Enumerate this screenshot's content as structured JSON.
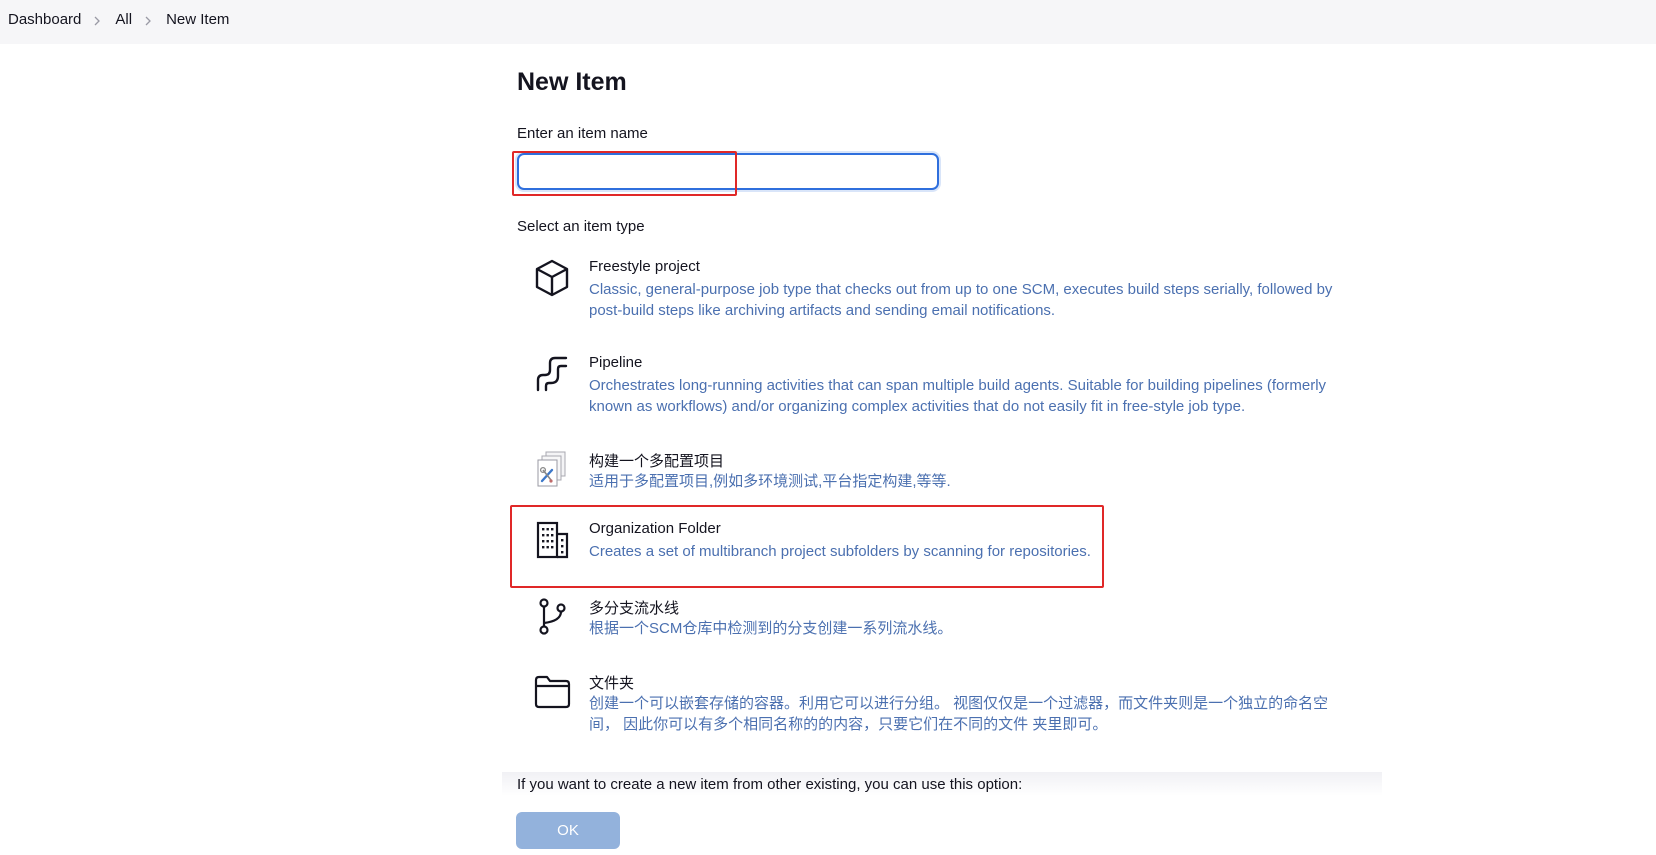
{
  "breadcrumb": {
    "items": [
      "Dashboard",
      "All",
      "New Item"
    ]
  },
  "page": {
    "title": "New Item",
    "name_label": "Enter an item name",
    "name_value": "",
    "type_label": "Select an item type"
  },
  "item_types": [
    {
      "icon": "cube-icon",
      "name": "Freestyle project",
      "desc": "Classic, general-purpose job type that checks out from up to one SCM, executes build steps serially, followed by post-build steps like archiving artifacts and sending email notifications."
    },
    {
      "icon": "pipeline-icon",
      "name": "Pipeline",
      "desc": "Orchestrates long-running activities that can span multiple build agents. Suitable for building pipelines (formerly known as workflows) and/or organizing complex activities that do not easily fit in free-style job type."
    },
    {
      "icon": "multi-config-icon",
      "name": "构建一个多配置项目",
      "desc": "适用于多配置项目,例如多环境测试,平台指定构建,等等."
    },
    {
      "icon": "building-icon",
      "name": "Organization Folder",
      "desc": "Creates a set of multibranch project subfolders by scanning for repositories."
    },
    {
      "icon": "branch-icon",
      "name": "多分支流水线",
      "desc": "根据一个SCM仓库中检测到的分支创建一系列流水线。"
    },
    {
      "icon": "folder-icon",
      "name": "文件夹",
      "desc": "创建一个可以嵌套存储的容器。利用它可以进行分组。 视图仅仅是一个过滤器，而文件夹则是一个独立的命名空间， 因此你可以有多个相同名称的的内容，只要它们在不同的文件 夹里即可。"
    }
  ],
  "copy_option": {
    "text": "If you want to create a new item from other existing, you can use this option:"
  },
  "ok_button": {
    "label": "OK"
  },
  "colors": {
    "accent": "#2f6fdd",
    "description": "#4b70b0",
    "ok_button": "#93b2dc",
    "annotation": "#e02828"
  }
}
